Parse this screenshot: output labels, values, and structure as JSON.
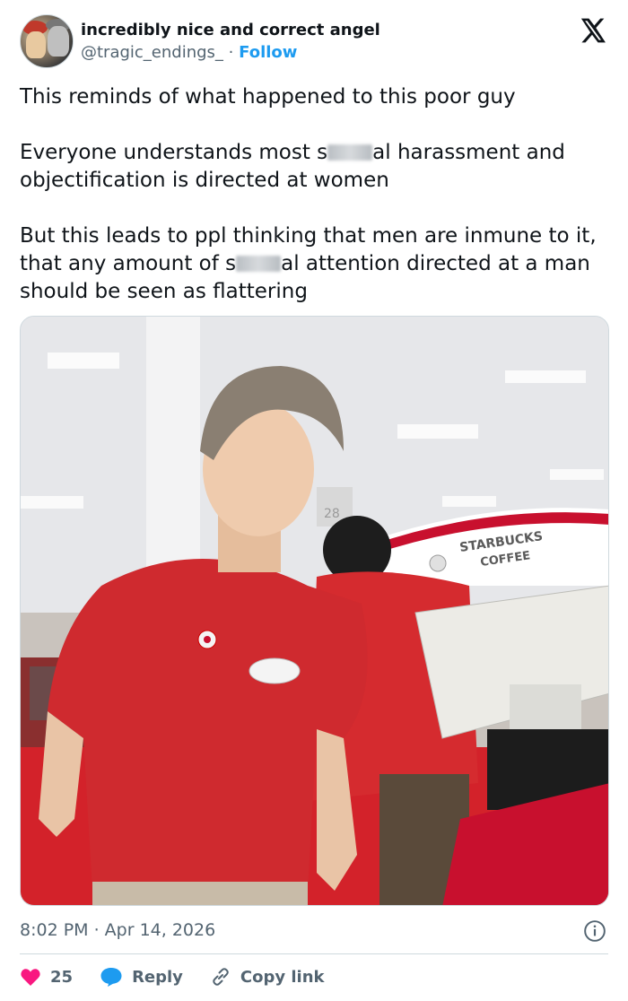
{
  "user": {
    "display_name": "incredibly nice and correct angel",
    "handle": "@tragic_endings_",
    "separator": "·",
    "follow_label": "Follow"
  },
  "tweet": {
    "paragraphs": [
      {
        "text": "This reminds of what happened to this poor guy"
      },
      {
        "before": "Everyone understands most s",
        "after": "al harassment and objectification is directed at women"
      },
      {
        "before": "But this leads to ppl thinking that men are inmune to it, that any amount of s",
        "after": "al attention directed at a man should be seen as flattering"
      }
    ]
  },
  "media": {
    "sign_text": "STARBUCKS",
    "sign_text2": "COFFEE",
    "aisle_number": "28"
  },
  "meta": {
    "timestamp": "8:02 PM · Apr 14, 2026"
  },
  "actions": {
    "like_count": "25",
    "reply_label": "Reply",
    "copy_link_label": "Copy link"
  },
  "colors": {
    "follow": "#1d9bf0",
    "like": "#f91880",
    "reply": "#1d9bf0",
    "muted": "#536471",
    "text": "#0f1419"
  },
  "icons": [
    "x-logo-icon",
    "info-icon",
    "heart-icon",
    "reply-bubble-icon",
    "link-icon"
  ]
}
